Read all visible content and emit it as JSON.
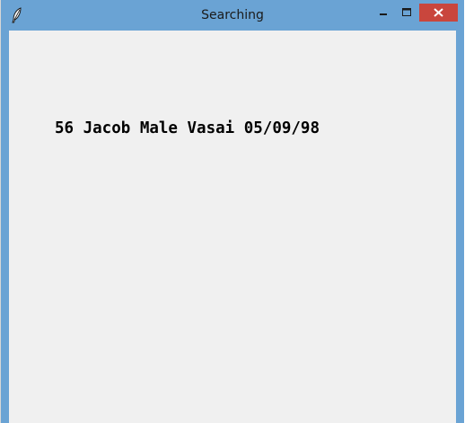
{
  "window": {
    "title": "Searching",
    "app_icon": "feather-icon"
  },
  "controls": {
    "minimize": "minimize-icon",
    "maximize": "maximize-icon",
    "close": "close-icon"
  },
  "content": {
    "record_text": "56 Jacob Male Vasai 05/09/98"
  },
  "colors": {
    "titlebar": "#6aa3d4",
    "close_button": "#c9463d",
    "client_background": "#f0f0f0"
  }
}
